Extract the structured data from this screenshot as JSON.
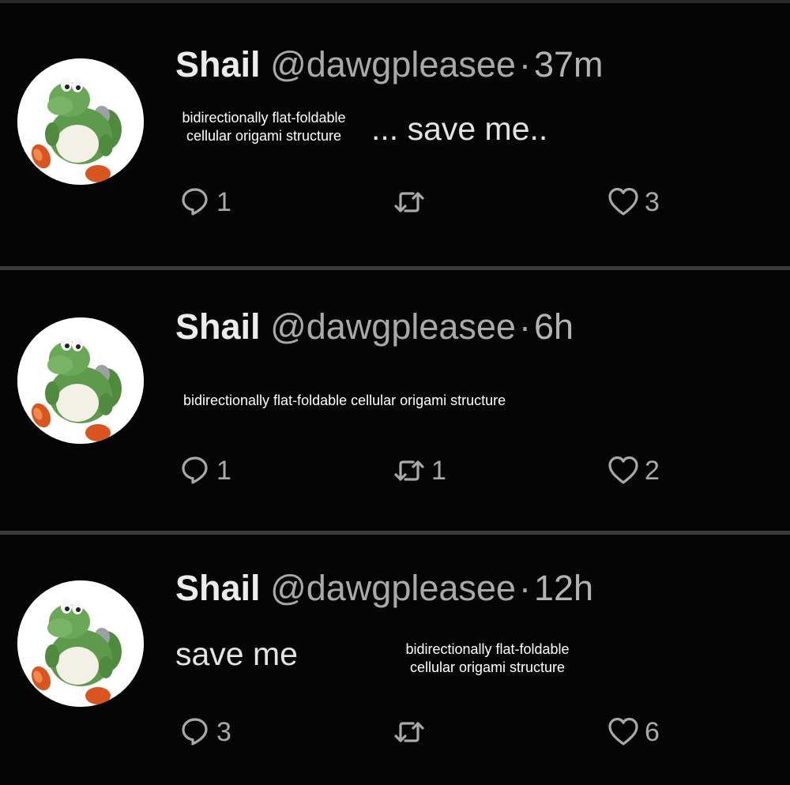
{
  "tweets": [
    {
      "name": "Shail",
      "handle": "@dawgpleasee",
      "separator": "·",
      "time": "37m",
      "caption_line1": "bidirectionally flat-foldable",
      "caption_line2": "cellular origami structure",
      "text": "... save me..",
      "replies": "1",
      "retweets": "",
      "likes": "3"
    },
    {
      "name": "Shail",
      "handle": "@dawgpleasee",
      "separator": "·",
      "time": "6h",
      "caption": "bidirectionally flat-foldable cellular origami structure",
      "replies": "1",
      "retweets": "1",
      "likes": "2"
    },
    {
      "name": "Shail",
      "handle": "@dawgpleasee",
      "separator": "·",
      "time": "12h",
      "text": "save me",
      "caption_line1": "bidirectionally flat-foldable",
      "caption_line2": "cellular origami structure",
      "replies": "3",
      "retweets": "",
      "likes": "6"
    }
  ],
  "icons": {
    "reply": "reply-bubble-icon",
    "retweet": "retweet-arrows-icon",
    "like": "heart-icon"
  },
  "colors": {
    "background": "#000000",
    "divider": "#3a3a3a",
    "text": "#e3e3e3",
    "muted": "#a9a9a9",
    "avatar_green": "#5e9a4c",
    "avatar_orange": "#d9541e"
  }
}
